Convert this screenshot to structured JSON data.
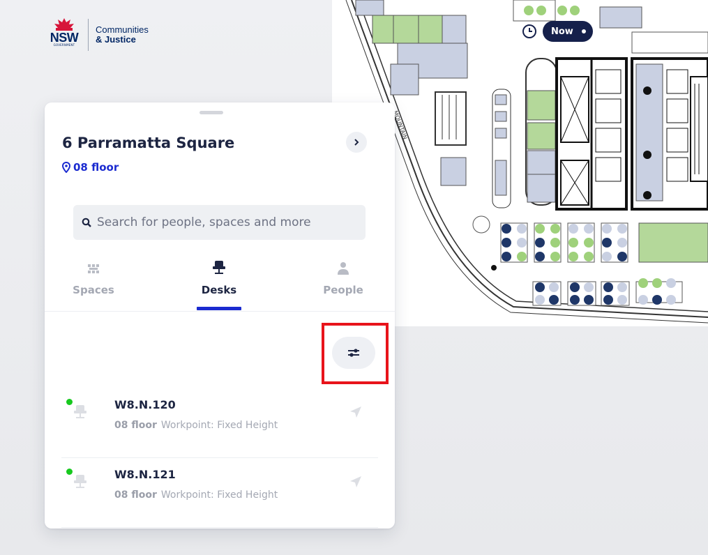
{
  "brand": {
    "nsw": "NSW",
    "government": "GOVERNMENT",
    "org_line1": "Communities",
    "org_line2": "& Justice"
  },
  "map": {
    "street_label": "MOUNTAIN",
    "time_button": "Now"
  },
  "panel": {
    "building": "6 Parramatta Square",
    "floor": "08 floor",
    "search_placeholder": "Search for people, spaces and more",
    "tabs": [
      {
        "label": "Spaces",
        "icon": "spaces-icon",
        "active": false
      },
      {
        "label": "Desks",
        "icon": "desk-chair-icon",
        "active": true
      },
      {
        "label": "People",
        "icon": "person-icon",
        "active": false
      }
    ],
    "desks": [
      {
        "name": "W8.N.120",
        "floor": "08 floor",
        "type": "Workpoint: Fixed Height",
        "status": "available"
      },
      {
        "name": "W8.N.121",
        "floor": "08 floor",
        "type": "Workpoint: Fixed Height",
        "status": "available"
      }
    ]
  },
  "colors": {
    "accent": "#1b2bd0",
    "navy": "#1d2542",
    "available": "#17c91e",
    "highlight": "#e8141b",
    "desk_green": "#9fd17b",
    "desk_navy": "#1f3768"
  }
}
